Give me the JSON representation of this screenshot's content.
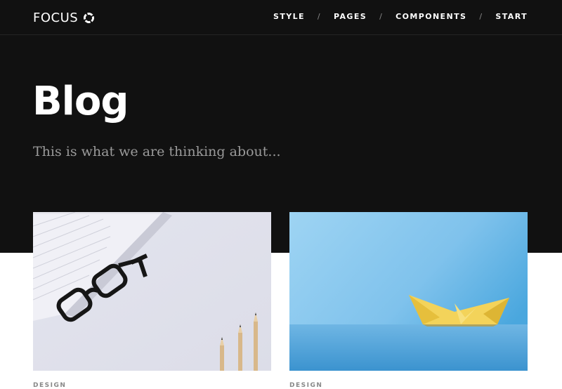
{
  "brand": {
    "name": "FOCUS",
    "icon": "ring-logo-icon"
  },
  "nav": {
    "items": [
      {
        "label": "STYLE"
      },
      {
        "label": "PAGES"
      },
      {
        "label": "COMPONENTS"
      },
      {
        "label": "START"
      }
    ],
    "separator": "/"
  },
  "hero": {
    "title": "Blog",
    "subtitle": "This is what we are thinking about..."
  },
  "posts": [
    {
      "image": "glasses-notebook-pencils-photo",
      "category": "DESIGN"
    },
    {
      "image": "paper-boat-photo",
      "category": "DESIGN"
    }
  ],
  "colors": {
    "header_bg": "#111111",
    "text_light": "#ffffff",
    "subtitle": "#9a9a9a",
    "page_bg": "#ffffff"
  }
}
